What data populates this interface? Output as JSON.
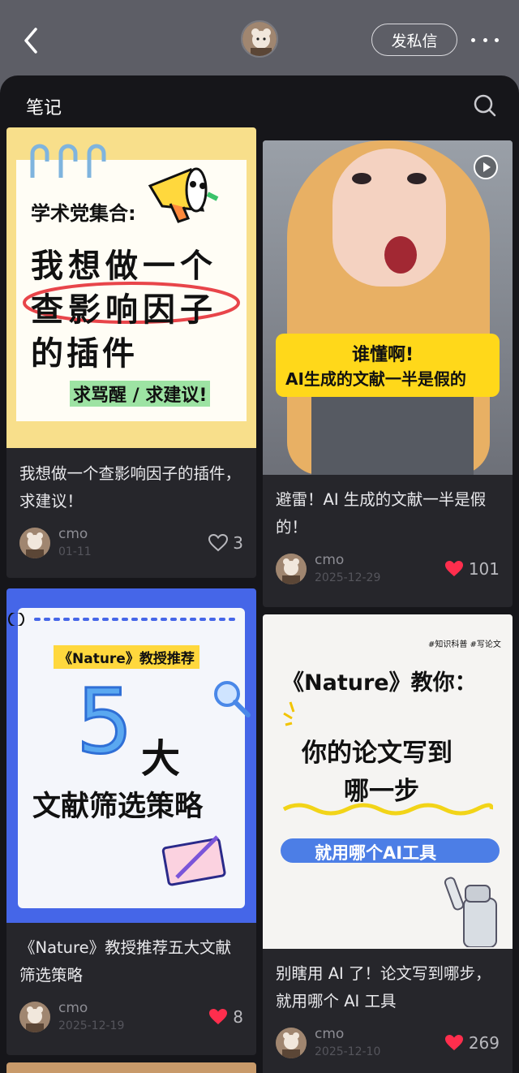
{
  "header": {
    "dm_button_label": "发私信"
  },
  "section": {
    "title": "笔记"
  },
  "notes": [
    {
      "cover_lines": [
        "学术党集合:",
        "我想做一个",
        "查影响因子",
        "的插件",
        "求骂醒 / 求建议!"
      ],
      "title": "我想做一个查影响因子的插件，求建议！",
      "author": "cmo",
      "date": "01-11",
      "likes": "3",
      "liked": false
    },
    {
      "cover_lines": [
        "谁懂啊!",
        "AI生成的文献一半是假的"
      ],
      "title": "避雷！AI 生成的文献一半是假的！",
      "author": "cmo",
      "date": "2025-12-29",
      "likes": "101",
      "liked": true,
      "is_video": true
    },
    {
      "cover_lines": [
        "《Nature》教授推荐",
        "5",
        "大",
        "文献筛选策略"
      ],
      "title": "《Nature》教授推荐五大文献筛选策略",
      "author": "cmo",
      "date": "2025-12-19",
      "likes": "8",
      "liked": true
    },
    {
      "cover_lines": [
        "#知识科普 #写论文",
        "《Nature》教你：",
        "你的论文写到",
        "哪一步",
        "就用哪个AI工具"
      ],
      "title": "别瞎用 AI 了！论文写到哪步，就用哪个 AI 工具",
      "author": "cmo",
      "date": "2025-12-10",
      "likes": "269",
      "liked": true
    }
  ],
  "icons": {
    "back": "chevron-left-icon",
    "more": "more-dots-icon",
    "search": "search-icon",
    "heart": "heart-icon",
    "play": "play-icon"
  },
  "colors": {
    "header_bg": "#5d5e66",
    "sheet_bg": "#16161a",
    "card_bg": "#26262b",
    "like_red": "#ff2e4d"
  }
}
